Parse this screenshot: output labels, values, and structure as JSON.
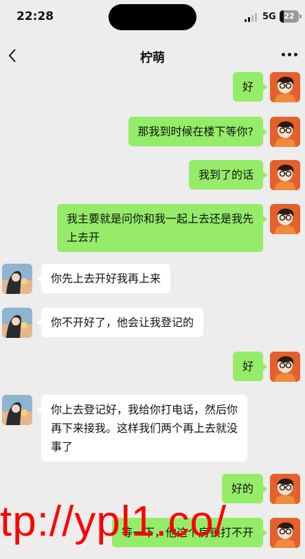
{
  "status": {
    "time": "22:28",
    "network": "5G",
    "battery": "22"
  },
  "header": {
    "title": "柠萌"
  },
  "messages": [
    {
      "from": "me",
      "text": "好"
    },
    {
      "from": "me",
      "text": "那我到时候在楼下等你?"
    },
    {
      "from": "me",
      "text": "我到了的话"
    },
    {
      "from": "me",
      "line1": "我主要就是问你和我一起上去还是我先",
      "line2": "上去开"
    },
    {
      "from": "her",
      "text": "你先上去开好我再上来"
    },
    {
      "from": "her",
      "text": "你不开好了，他会让我登记的"
    },
    {
      "from": "me",
      "text": "好"
    },
    {
      "from": "her",
      "line1": "你上去登记好，我给你打电话，然后你",
      "line2": "再下来接我。这样我们两个再上去就没",
      "line3": "事了"
    },
    {
      "from": "me",
      "text": "好的"
    },
    {
      "from": "me",
      "text": "等一下，他这个房锁打不开"
    }
  ],
  "watermark": "tp://ypl1.co/",
  "colors": {
    "outgoing_bubble": "#95ec69",
    "incoming_bubble": "#ffffff",
    "background": "#ededed",
    "watermark": "#ff0000"
  },
  "icons": {
    "back": "back-chevron-icon",
    "more": "more-dots-icon"
  }
}
